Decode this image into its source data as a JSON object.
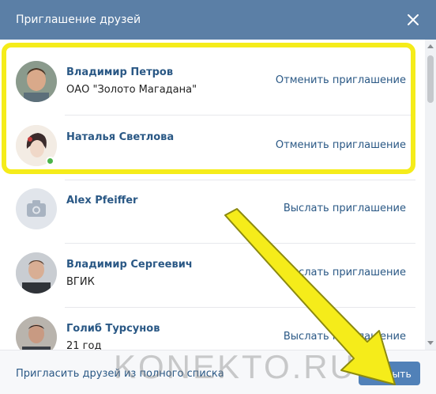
{
  "dialog": {
    "title": "Приглашение друзей"
  },
  "friends": [
    {
      "name": "Владимир Петров",
      "sub": "ОАО \"Золото Магадана\"",
      "action": "Отменить приглашение"
    },
    {
      "name": "Наталья Светлова",
      "sub": "",
      "action": "Отменить приглашение"
    },
    {
      "name": "Alex Pfeiffer",
      "sub": "",
      "action": "Выслать приглашение"
    },
    {
      "name": "Владимир Сергеевич",
      "sub": "ВГИК",
      "action": "Выслать приглашение"
    },
    {
      "name": "Голиб Турсунов",
      "sub": "21 год",
      "action": "Выслать приглашение"
    }
  ],
  "footer": {
    "invite_link": "Пригласить друзей из полного списка",
    "close_button": "Закрыть"
  },
  "watermark": "KONEKTO.RU",
  "colors": {
    "header": "#5b7fa6",
    "link": "#2a5885",
    "button": "#5181b8",
    "highlight": "#f5ec1a",
    "arrow": "#f5ec1a"
  }
}
